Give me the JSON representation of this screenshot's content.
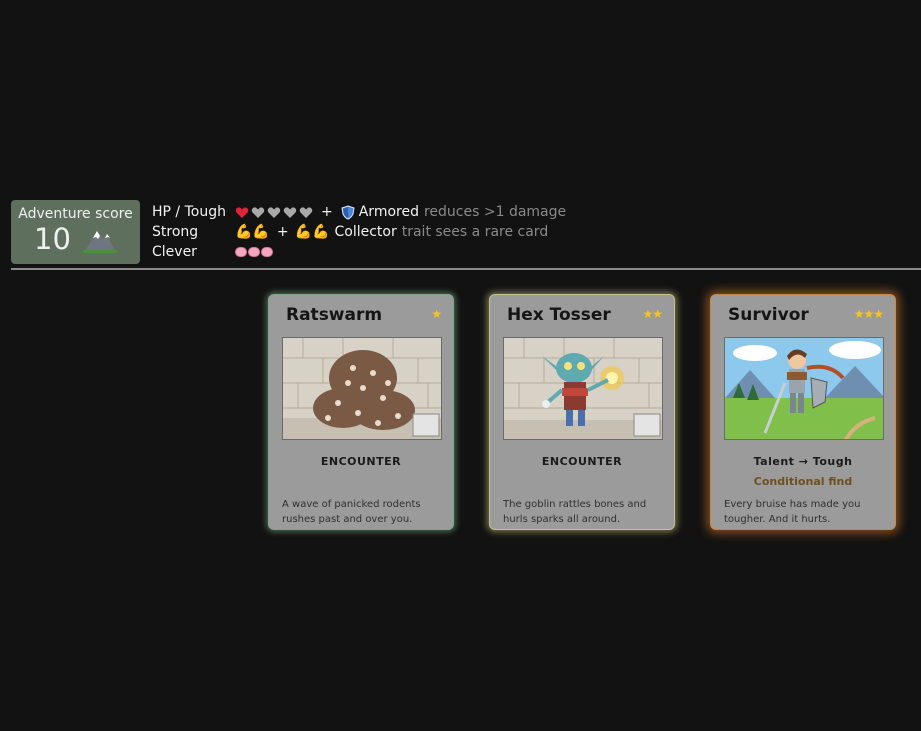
{
  "score": {
    "label": "Adventure score",
    "value": "10",
    "icon": "mountain-icon"
  },
  "stats": {
    "hp": {
      "label": "HP / Tough",
      "hearts_full": 1,
      "hearts_total": 5,
      "plus": "+",
      "trait": "Armored",
      "note": "reduces >1 damage",
      "trait_icon": "shield-icon"
    },
    "strong": {
      "label": "Strong",
      "icon_left": "💪💪",
      "plus": "+",
      "icon_right": "💪💪",
      "trait": "Collector",
      "note": "trait sees a rare card"
    },
    "clever": {
      "label": "Clever",
      "brains": 3,
      "icon": "brain-icon"
    }
  },
  "cards": [
    {
      "title": "Ratswarm",
      "stars": "★",
      "type": "ENCOUNTER",
      "subtitle": "",
      "description": "A wave of panicked rodents rushes past and over you.",
      "glow": "#8cc896"
    },
    {
      "title": "Hex Tosser",
      "stars": "★★",
      "type": "ENCOUNTER",
      "subtitle": "",
      "description": "The goblin rattles bones and hurls sparks all around.",
      "glow": "#e6dc8c"
    },
    {
      "title": "Survivor",
      "stars": "★★★",
      "type": "Talent → Tough",
      "subtitle": "Conditional find",
      "description": "Every bruise has made you tougher. And it hurts.",
      "glow": "#e68228"
    }
  ]
}
